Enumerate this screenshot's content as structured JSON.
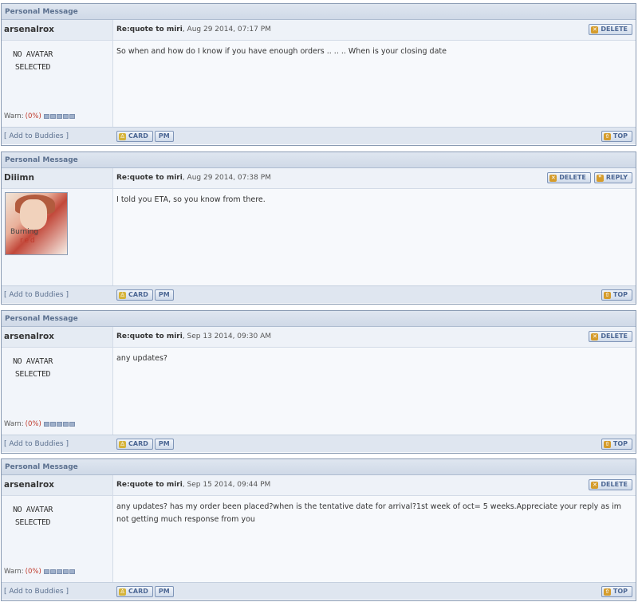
{
  "section_label": "Personal Message",
  "buttons": {
    "delete": "DELETE",
    "reply": "REPLY",
    "card": "CARD",
    "pm": "PM",
    "top": "TOP"
  },
  "buddy_label": "[ Add to Buddies ]",
  "warn_label": "Warn:",
  "warn_pct": "(0%)",
  "no_avatar_line1": "NO AVATAR",
  "no_avatar_line2": "SELECTED",
  "posts": [
    {
      "author": "arsenalrox",
      "subject": "Re:quote to miri",
      "date": ", Aug 29 2014, 07:17 PM",
      "body": "So when and how do I know if you have enough orders .. .. .. When is your closing date"
    },
    {
      "author": "Diiimn",
      "subject": "Re:quote to miri",
      "date": ", Aug 29 2014, 07:38 PM",
      "body": "I told you ETA, so you know from there.",
      "avatar_text1": "Burning",
      "avatar_text2": "red"
    },
    {
      "author": "arsenalrox",
      "subject": "Re:quote to miri",
      "date": ", Sep 13 2014, 09:30 AM",
      "body": "any updates?"
    },
    {
      "author": "arsenalrox",
      "subject": "Re:quote to miri",
      "date": ", Sep 15 2014, 09:44 PM",
      "body": "any updates? has my order been placed?when is the tentative date for arrival?1st week of oct= 5 weeks.Appreciate your reply as im not getting much response from you"
    }
  ]
}
